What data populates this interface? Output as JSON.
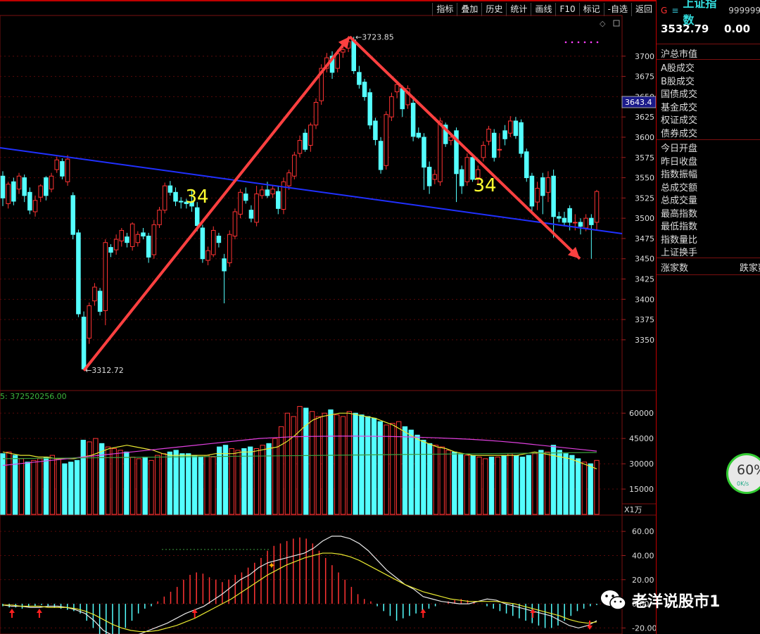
{
  "toolbar": [
    "指标",
    "叠加",
    "历史",
    "统计",
    "画线",
    "F10",
    "标记",
    "-自选",
    "返回"
  ],
  "chart_data": {
    "type": "candlestick",
    "title": "",
    "ylim": [
      3290,
      3745
    ],
    "y_ticks": [
      3350,
      3375,
      3400,
      3425,
      3450,
      3475,
      3500,
      3525,
      3550,
      3575,
      3600,
      3625,
      3650,
      3675,
      3700
    ],
    "current_price_label": "3643.4",
    "high_label": "3723.85",
    "low_label": "3312.72",
    "wave_labels": [
      "34",
      "34"
    ],
    "candles": [
      [
        3552,
        3525,
        3558,
        3515
      ],
      [
        3518,
        3542,
        3545,
        3512
      ],
      [
        3545,
        3521,
        3550,
        3516
      ],
      [
        3536,
        3552,
        3556,
        3530
      ],
      [
        3550,
        3528,
        3554,
        3520
      ],
      [
        3532,
        3510,
        3538,
        3505
      ],
      [
        3508,
        3522,
        3528,
        3502
      ],
      [
        3526,
        3540,
        3542,
        3520
      ],
      [
        3550,
        3528,
        3552,
        3522
      ],
      [
        3536,
        3552,
        3556,
        3532
      ],
      [
        3560,
        3572,
        3576,
        3556
      ],
      [
        3570,
        3552,
        3574,
        3548
      ],
      [
        3545,
        3573,
        3578,
        3540
      ],
      [
        3528,
        3480,
        3532,
        3474
      ],
      [
        3482,
        3382,
        3486,
        3378
      ],
      [
        3378,
        3314,
        3385,
        3313
      ],
      [
        3352,
        3392,
        3396,
        3345
      ],
      [
        3398,
        3415,
        3420,
        3392
      ],
      [
        3410,
        3385,
        3414,
        3380
      ],
      [
        3386,
        3470,
        3474,
        3368
      ],
      [
        3464,
        3458,
        3468,
        3452
      ],
      [
        3461,
        3474,
        3480,
        3455
      ],
      [
        3472,
        3485,
        3488,
        3465
      ],
      [
        3477,
        3470,
        3482,
        3464
      ],
      [
        3465,
        3493,
        3495,
        3460
      ],
      [
        3470,
        3480,
        3484,
        3465
      ],
      [
        3482,
        3478,
        3488,
        3474
      ],
      [
        3478,
        3452,
        3482,
        3445
      ],
      [
        3455,
        3492,
        3498,
        3450
      ],
      [
        3492,
        3510,
        3514,
        3488
      ],
      [
        3510,
        3540,
        3544,
        3506
      ],
      [
        3540,
        3532,
        3546,
        3528
      ],
      [
        3532,
        3521,
        3538,
        3515
      ],
      [
        3521,
        3520,
        3526,
        3512
      ],
      [
        3520,
        3518,
        3524,
        3512
      ],
      [
        3520,
        3515,
        3535,
        3508
      ],
      [
        3513,
        3491,
        3520,
        3484
      ],
      [
        3488,
        3450,
        3492,
        3445
      ],
      [
        3448,
        3460,
        3465,
        3442
      ],
      [
        3455,
        3485,
        3490,
        3452
      ],
      [
        3478,
        3470,
        3482,
        3464
      ],
      [
        3450,
        3435,
        3456,
        3395
      ],
      [
        3445,
        3480,
        3485,
        3440
      ],
      [
        3478,
        3508,
        3512,
        3474
      ],
      [
        3505,
        3532,
        3536,
        3500
      ],
      [
        3530,
        3522,
        3538,
        3518
      ],
      [
        3510,
        3500,
        3516,
        3495
      ],
      [
        3495,
        3530,
        3540,
        3490
      ],
      [
        3528,
        3535,
        3540,
        3524
      ],
      [
        3535,
        3528,
        3545,
        3525
      ],
      [
        3530,
        3536,
        3540,
        3525
      ],
      [
        3533,
        3512,
        3540,
        3505
      ],
      [
        3511,
        3545,
        3550,
        3505
      ],
      [
        3540,
        3556,
        3560,
        3535
      ],
      [
        3552,
        3578,
        3582,
        3548
      ],
      [
        3580,
        3596,
        3602,
        3575
      ],
      [
        3605,
        3585,
        3610,
        3582
      ],
      [
        3590,
        3615,
        3618,
        3582
      ],
      [
        3615,
        3643,
        3648,
        3610
      ],
      [
        3645,
        3685,
        3690,
        3640
      ],
      [
        3685,
        3698,
        3704,
        3680
      ],
      [
        3700,
        3680,
        3706,
        3672
      ],
      [
        3685,
        3703,
        3708,
        3680
      ],
      [
        3705,
        3708,
        3715,
        3698
      ],
      [
        3710,
        3718,
        3724,
        3705
      ],
      [
        3720,
        3682,
        3724,
        3678
      ],
      [
        3680,
        3665,
        3688,
        3660
      ],
      [
        3668,
        3650,
        3672,
        3645
      ],
      [
        3655,
        3615,
        3660,
        3610
      ],
      [
        3620,
        3597,
        3624,
        3590
      ],
      [
        3595,
        3560,
        3600,
        3555
      ],
      [
        3565,
        3628,
        3632,
        3560
      ],
      [
        3625,
        3650,
        3655,
        3620
      ],
      [
        3656,
        3665,
        3668,
        3648
      ],
      [
        3660,
        3635,
        3664,
        3625
      ],
      [
        3640,
        3660,
        3664,
        3635
      ],
      [
        3642,
        3601,
        3648,
        3595
      ],
      [
        3605,
        3600,
        3612,
        3598
      ],
      [
        3600,
        3563,
        3605,
        3535
      ],
      [
        3563,
        3540,
        3570,
        3530
      ],
      [
        3548,
        3554,
        3560,
        3542
      ],
      [
        3545,
        3620,
        3624,
        3540
      ],
      [
        3615,
        3592,
        3618,
        3588
      ],
      [
        3596,
        3600,
        3605,
        3590
      ],
      [
        3608,
        3555,
        3612,
        3520
      ],
      [
        3560,
        3540,
        3565,
        3530
      ],
      [
        3545,
        3575,
        3580,
        3540
      ],
      [
        3575,
        3548,
        3580,
        3545
      ],
      [
        3550,
        3560,
        3565,
        3542
      ],
      [
        3575,
        3590,
        3595,
        3570
      ],
      [
        3595,
        3610,
        3614,
        3590
      ],
      [
        3605,
        3575,
        3610,
        3570
      ],
      [
        3585,
        3585,
        3605,
        3575
      ],
      [
        3608,
        3598,
        3615,
        3590
      ],
      [
        3605,
        3620,
        3626,
        3600
      ],
      [
        3620,
        3602,
        3625,
        3598
      ],
      [
        3618,
        3580,
        3622,
        3575
      ],
      [
        3582,
        3550,
        3586,
        3545
      ],
      [
        3552,
        3515,
        3556,
        3505
      ],
      [
        3520,
        3537,
        3545,
        3510
      ],
      [
        3550,
        3528,
        3556,
        3505
      ],
      [
        3532,
        3550,
        3558,
        3520
      ],
      [
        3552,
        3502,
        3560,
        3476
      ],
      [
        3502,
        3500,
        3508,
        3495
      ],
      [
        3500,
        3495,
        3508,
        3490
      ],
      [
        3512,
        3495,
        3516,
        3485
      ],
      [
        3495,
        3495,
        3505,
        3485
      ],
      [
        3495,
        3490,
        3500,
        3480
      ],
      [
        3488,
        3500,
        3505,
        3484
      ],
      [
        3500,
        3492,
        3505,
        3450
      ],
      [
        3495,
        3533,
        3535,
        3485
      ]
    ],
    "volume": {
      "y_ticks": [
        15000,
        30000,
        45000,
        60000
      ],
      "ylim": [
        0,
        68000
      ],
      "unit_label": "X1万",
      "header": "5: 372520256.00",
      "values": [
        36000,
        37000,
        35000,
        33000,
        31000,
        32000,
        33000,
        34000,
        35000,
        33000,
        30000,
        31000,
        32000,
        44000,
        43000,
        45000,
        42000,
        40000,
        39000,
        38000,
        37000,
        34000,
        33000,
        34000,
        32000,
        35000,
        36000,
        37000,
        38000,
        36000,
        36000,
        35000,
        34000,
        35000,
        34000,
        40000,
        41000,
        39000,
        38000,
        39000,
        40000,
        39000,
        41000,
        42000,
        45000,
        52000,
        60000,
        58000,
        64000,
        63000,
        61000,
        58000,
        60000,
        62000,
        59000,
        58000,
        61000,
        60000,
        59000,
        58000,
        57000,
        55000,
        53000,
        54000,
        55000,
        52000,
        50000,
        47000,
        44000,
        42000,
        41000,
        40000,
        38000,
        37000,
        36000,
        35000,
        35000,
        34000,
        33000,
        34000,
        34000,
        35000,
        36000,
        35000,
        34000,
        35000,
        36000,
        38000,
        37000,
        41000,
        38000,
        36000,
        35000,
        33000,
        31000,
        30000,
        32000
      ],
      "ma_yellow": [
        37000,
        36000,
        35000,
        35000,
        34000,
        34000,
        33000,
        33000,
        33000,
        34000,
        35000,
        37000,
        39000,
        40000,
        41000,
        40000,
        39000,
        38000,
        36000,
        35000,
        35000,
        35000,
        35000,
        35000,
        36000,
        36000,
        36000,
        37000,
        37000,
        38000,
        39000,
        40000,
        43000,
        47000,
        52000,
        56000,
        58000,
        59000,
        60000,
        60000,
        59000,
        58000,
        57000,
        55000,
        53000,
        50000,
        47000,
        44000,
        42000,
        40000,
        39000,
        37000,
        36000,
        35000,
        35000,
        35000,
        35000,
        35000,
        35000,
        36000,
        37000,
        36000,
        35000,
        34000,
        33000,
        31000,
        29000,
        27000
      ],
      "ma_magenta": [
        29000,
        30000,
        31000,
        32000,
        33000,
        34000,
        35000,
        36000,
        37000,
        38000,
        39000,
        40000,
        41000,
        42000,
        43000,
        44000,
        45000,
        45500,
        46000,
        46200,
        46300,
        46400,
        46400,
        46300,
        46200,
        46000,
        45700,
        45400,
        45000,
        44600,
        44000,
        43300,
        42500,
        41500,
        40500,
        39500,
        38500,
        37500
      ],
      "ma_green": [
        33000,
        33100,
        33200,
        33300,
        33400,
        33500,
        33600,
        33700,
        33800,
        33900,
        34000,
        34100,
        34200,
        34300,
        34400,
        34500,
        34600,
        34700,
        34800,
        34900,
        35000,
        35100,
        35200,
        35300,
        35400,
        35500,
        35600,
        35700,
        35800,
        35900,
        36000,
        36100,
        36200,
        36300,
        36400,
        36500,
        36600,
        36700
      ]
    },
    "macd": {
      "y_ticks": [
        60,
        40,
        20,
        0,
        -20
      ],
      "y_tick_labels": [
        "60.00",
        "40.00",
        "20.00",
        "0.00",
        "-20.00"
      ],
      "ylim": [
        -25,
        70
      ],
      "hist": [
        -2,
        -3,
        -3,
        -4,
        -3,
        -2,
        -1,
        -2,
        -3,
        -4,
        -5,
        -6,
        -8,
        -14,
        -20,
        -27,
        -30,
        -29,
        -25,
        -20,
        -14,
        -8,
        -4,
        -2,
        2,
        6,
        10,
        14,
        20,
        24,
        26,
        25,
        22,
        20,
        18,
        20,
        24,
        26,
        30,
        34,
        38,
        44,
        48,
        50,
        52,
        54,
        55,
        54,
        50,
        44,
        38,
        32,
        26,
        20,
        14,
        8,
        4,
        2,
        -2,
        -6,
        -10,
        -14,
        -12,
        -10,
        -8,
        -6,
        -4,
        -2,
        0,
        2,
        3,
        4,
        3,
        2,
        0,
        -2,
        -4,
        -6,
        -8,
        -10,
        -12,
        -14,
        -16,
        -18,
        -20,
        -20,
        -18,
        -14,
        -10,
        -6,
        -4,
        -2,
        -1
      ],
      "dif": [
        -1,
        -2,
        -2,
        -3,
        -3,
        -2,
        -2,
        -3,
        -5,
        -8,
        -14,
        -22,
        -26,
        -28,
        -27,
        -25,
        -22,
        -19,
        -16,
        -12,
        -8,
        -5,
        -2,
        3,
        8,
        14,
        20,
        24,
        30,
        34,
        36,
        38,
        40,
        42,
        46,
        52,
        56,
        56,
        54,
        50,
        44,
        36,
        28,
        22,
        16,
        12,
        6,
        4,
        2,
        1,
        0,
        0,
        2,
        4,
        3,
        0,
        -2,
        -4,
        -6,
        -8,
        -10,
        -14,
        -18,
        -20,
        -18,
        -14
      ],
      "dea": [
        -1,
        -1,
        -2,
        -2,
        -2,
        -3,
        -3,
        -3,
        -4,
        -6,
        -9,
        -13,
        -17,
        -20,
        -22,
        -23,
        -23,
        -22,
        -20,
        -18,
        -15,
        -12,
        -8,
        -4,
        0,
        4,
        9,
        14,
        19,
        24,
        28,
        32,
        35,
        38,
        40,
        42,
        42,
        41,
        39,
        36,
        32,
        28,
        24,
        20,
        16,
        13,
        10,
        8,
        6,
        4,
        3,
        2,
        2,
        2,
        2,
        1,
        0,
        -2,
        -4,
        -6,
        -8,
        -10,
        -13,
        -15,
        -16,
        -15
      ],
      "buy_markers": [
        1,
        4,
        21,
        46,
        58
      ],
      "dotted_level": 45,
      "dotted_range": [
        16,
        28
      ]
    }
  },
  "sidebar": {
    "g": "G",
    "eq": "≡",
    "name": "上证指数",
    "code": "999999",
    "price": "3532.79",
    "change": "0.00",
    "total_mv": "沪总市值",
    "turnover_items": [
      "A股成交",
      "B股成交",
      "国债成交",
      "基金成交",
      "权证成交",
      "债券成交"
    ],
    "stat_items": [
      "今日开盘",
      "昨日收盘",
      "指数振幅",
      "总成交额",
      "总成交量",
      "最高指数",
      "最低指数",
      "指数量比",
      "上证换手"
    ],
    "up_label": "涨家数",
    "down_label": "跌家数"
  },
  "watermark": "老洋说股市1",
  "gauge": {
    "pct": "60%",
    "speed": "0K/s"
  }
}
